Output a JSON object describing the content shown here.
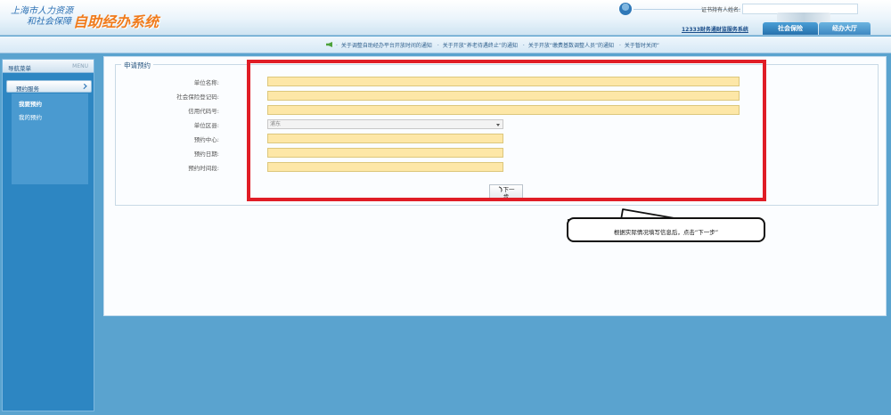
{
  "header": {
    "org_line1": "上海市人力资源",
    "org_line2": "和社会保障",
    "system_name": "自助经办系统",
    "user_label": "证书持有人姓名:",
    "user_value": "",
    "link_12333": "12333财务通财监服务系统",
    "tab_social": "社会保险",
    "tab_hall": "经办大厅"
  },
  "notices": [
    "关于调整自助经办平台开放时间的通知",
    "关于开放“养老待遇终止”的通知",
    "关于开放“缴费基数调整人员”的通知",
    "关于暂时关闭“"
  ],
  "sidebar": {
    "title": "导航菜单",
    "menu_label": "MENU",
    "group_label": "预约服务",
    "items": [
      "我要预约",
      "我的预约"
    ]
  },
  "form": {
    "legend": "申请预约",
    "fields": [
      {
        "label": "单位名称:",
        "value": ""
      },
      {
        "label": "社会保险登记码:",
        "value": ""
      },
      {
        "label": "信用代码号:",
        "value": ""
      },
      {
        "label": "单位区县:",
        "value": "浦东"
      },
      {
        "label": "预约中心:",
        "value": ""
      },
      {
        "label": "预约日期:",
        "value": ""
      },
      {
        "label": "预约时间段:",
        "value": ""
      }
    ],
    "next_button_line1": "下一",
    "next_button_line2": "步"
  },
  "callout": {
    "text": "根据实际情况填写信息后，点击“下一步”"
  },
  "colors": {
    "highlight": "#e01d26",
    "input_fill": "#fde7a7",
    "sidebar": "#2d86c2",
    "brand_orange": "#f07b1c"
  }
}
